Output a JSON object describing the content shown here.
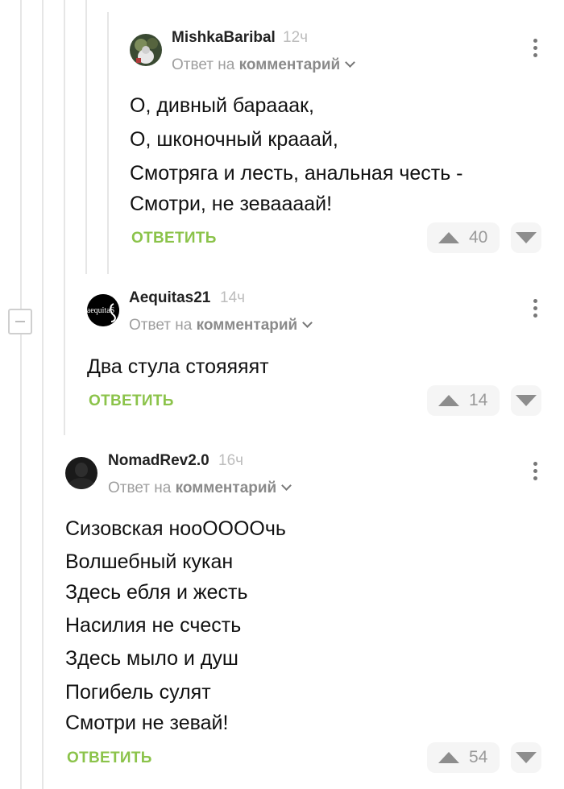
{
  "comments": [
    {
      "author": "MishkaBaribal",
      "time": "12ч",
      "reply_prefix": "Ответ на",
      "reply_link": "комментарий",
      "body": [
        "О, дивный барааак,",
        "О, шконочный крааай,",
        "Смотряга и лесть, анальная честь -",
        "Смотри, не зеваааай!"
      ],
      "reply_label": "ОТВЕТИТЬ",
      "votes": "40"
    },
    {
      "author": "Aequitas21",
      "time": "14ч",
      "reply_prefix": "Ответ на",
      "reply_link": "комментарий",
      "avatar_text": "aequitaS",
      "body": [
        "Два стула стояяяят"
      ],
      "reply_label": "ОТВЕТИТЬ",
      "votes": "14"
    },
    {
      "author": "NomadRev2.0",
      "time": "16ч",
      "reply_prefix": "Ответ на",
      "reply_link": "комментарий",
      "body": [
        "Сизовская нооОООOчь",
        "Волшебный кукан",
        "Здесь ебля и жесть",
        "Насилия не счесть",
        "Здесь мыло и душ",
        "Погибель сулят",
        "Смотри не зевай!"
      ],
      "reply_label": "ОТВЕТИТЬ",
      "votes": "54"
    }
  ]
}
